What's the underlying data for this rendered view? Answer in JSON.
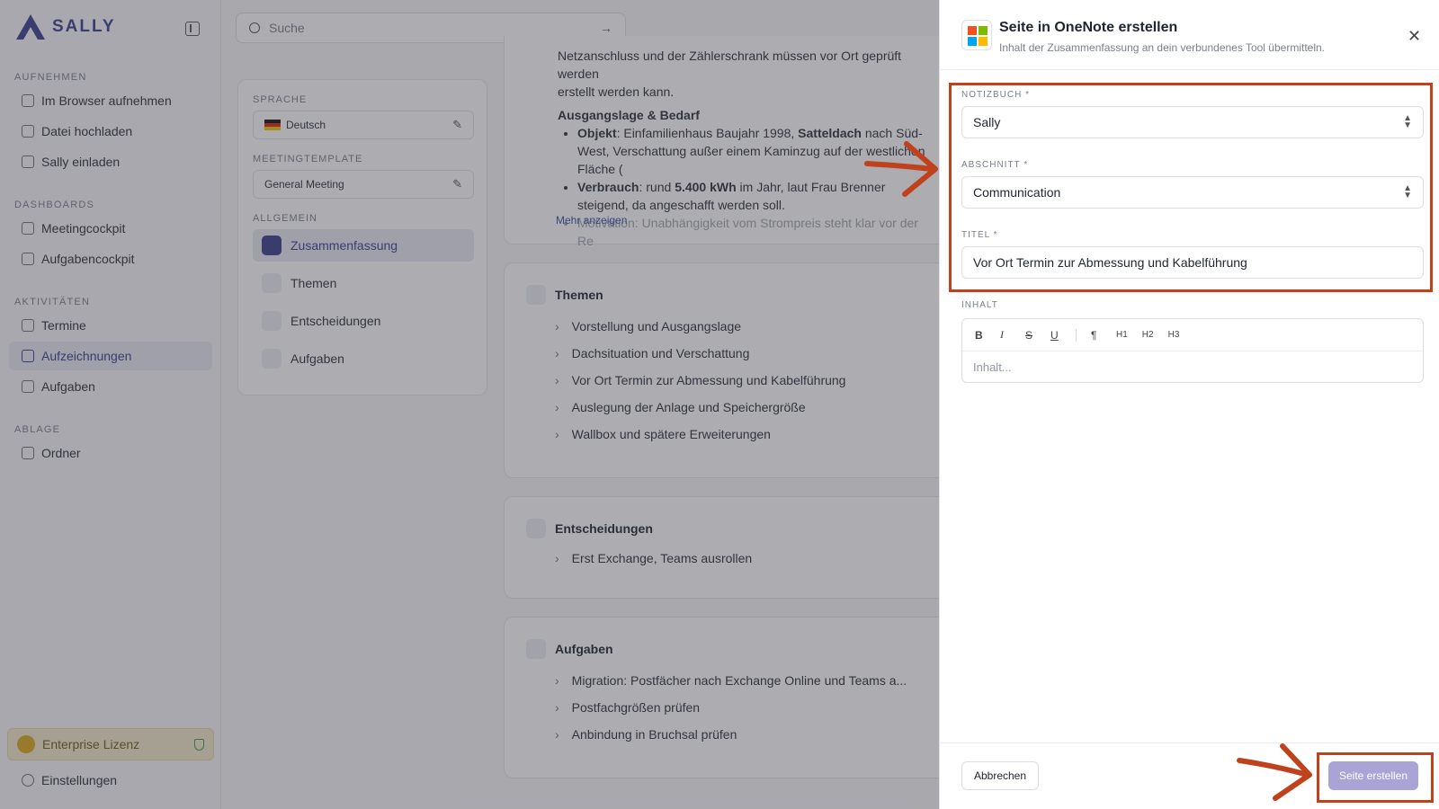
{
  "app": {
    "name": "SALLY"
  },
  "sidebar": {
    "sections": [
      {
        "label": "AUFNEHMEN",
        "items": [
          {
            "label": "Im Browser aufnehmen",
            "icon": "microphone-icon"
          },
          {
            "label": "Datei hochladen",
            "icon": "upload-icon"
          },
          {
            "label": "Sally einladen",
            "icon": "user-plus-icon"
          }
        ]
      },
      {
        "label": "DASHBOARDS",
        "items": [
          {
            "label": "Meetingcockpit",
            "icon": "grid-icon"
          },
          {
            "label": "Aufgabencockpit",
            "icon": "checkbox-icon"
          }
        ]
      },
      {
        "label": "AKTIVITÄTEN",
        "items": [
          {
            "label": "Termine",
            "icon": "calendar-icon"
          },
          {
            "label": "Aufzeichnungen",
            "icon": "waveform-icon",
            "active": true
          },
          {
            "label": "Aufgaben",
            "icon": "task-list-icon"
          }
        ]
      },
      {
        "label": "ABLAGE",
        "items": [
          {
            "label": "Ordner",
            "icon": "folder-icon"
          }
        ]
      }
    ],
    "license": "Enterprise Lizenz",
    "settings": "Einstellungen"
  },
  "search": {
    "placeholder": "Suche"
  },
  "left_panel": {
    "language_label": "SPRACHE",
    "language_value": "Deutsch",
    "template_label": "MEETINGTEMPLATE",
    "template_value": "General Meeting",
    "general_label": "ALLGEMEIN",
    "menu": [
      "Zusammenfassung",
      "Themen",
      "Entscheidungen",
      "Aufgaben"
    ]
  },
  "summary": {
    "top_line_1": "Netzanschluss und der Zählerschrank müssen vor Ort geprüft werden",
    "top_line_2": "erstellt werden kann.",
    "heading": "Ausgangslage & Bedarf",
    "bullet1_label": "Objekt",
    "bullet1_text": ": Einfamilienhaus Baujahr 1998, ",
    "bullet1_bold": "Satteldach",
    "bullet1_rest": " nach Süd-West, Verschattung außer einem Kaminzug auf der westlichen Fläche (",
    "bullet2_label": "Verbrauch",
    "bullet2_text": ": rund ",
    "bullet2_bold": "5.400 kWh",
    "bullet2_rest": " im Jahr, laut Frau Brenner steigend, da angeschafft werden soll.",
    "bullet3": "Motivation: Unabhängigkeit vom Strompreis steht klar vor der Re",
    "more": "Mehr anzeigen"
  },
  "themen": {
    "title": "Themen",
    "items": [
      "Vorstellung und Ausgangslage",
      "Dachsituation und Verschattung",
      "Vor Ort Termin zur Abmessung und Kabelführung",
      "Auslegung der Anlage und Speichergröße",
      "Wallbox und spätere Erweiterungen"
    ]
  },
  "entscheidungen": {
    "title": "Entscheidungen",
    "items": [
      "Erst Exchange, Teams ausrollen"
    ]
  },
  "aufgaben": {
    "title": "Aufgaben",
    "items": [
      "Migration: Postfächer nach Exchange Online und Teams a...",
      "Postfachgrößen prüfen",
      "Anbindung in Bruchsal prüfen"
    ]
  },
  "drawer": {
    "title": "Seite in OneNote erstellen",
    "subtitle": "Inhalt der Zusammenfassung an dein verbundenes Tool übermitteln.",
    "notebook_label": "NOTIZBUCH *",
    "notebook_value": "Sally",
    "section_label": "ABSCHNITT *",
    "section_value": "Communication",
    "title_label": "TITEL *",
    "title_value": "Vor Ort Termin zur Abmessung und Kabelführung",
    "content_label": "INHALT",
    "content_placeholder": "Inhalt...",
    "toolbar": [
      "B",
      "I",
      "S",
      "U",
      "¶",
      "H1",
      "H2",
      "H3"
    ],
    "cancel": "Abbrechen",
    "create": "Seite erstellen"
  },
  "colors": {
    "accent": "#3a3d8c",
    "annotation": "#c0421c",
    "create_button": "#a9a3d6"
  }
}
